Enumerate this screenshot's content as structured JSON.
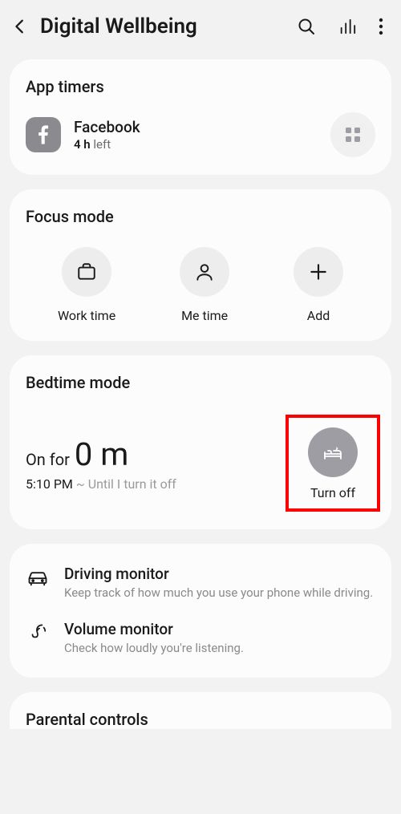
{
  "header": {
    "title": "Digital Wellbeing"
  },
  "appTimers": {
    "title": "App timers",
    "app": {
      "name": "Facebook",
      "remaining": "4 h",
      "suffix": "left"
    }
  },
  "focusMode": {
    "title": "Focus mode",
    "items": [
      {
        "label": "Work time"
      },
      {
        "label": "Me time"
      },
      {
        "label": "Add"
      }
    ]
  },
  "bedtime": {
    "title": "Bedtime mode",
    "onForLabel": "On for",
    "onForValue": "0 m",
    "startTime": "5:10 PM",
    "tilde": "~",
    "endText": "Until I turn it off",
    "turnOffLabel": "Turn off"
  },
  "monitors": {
    "driving": {
      "title": "Driving monitor",
      "desc": "Keep track of how much you use your phone while driving."
    },
    "volume": {
      "title": "Volume monitor",
      "desc": "Check how loudly you're listening."
    }
  },
  "parental": {
    "title": "Parental controls"
  }
}
